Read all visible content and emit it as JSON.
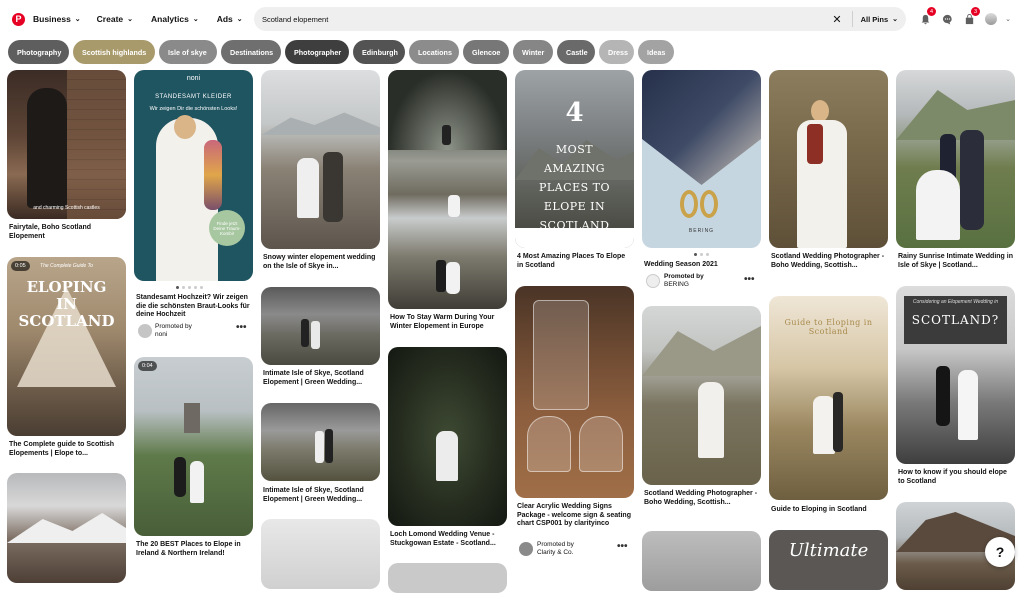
{
  "nav": {
    "business": "Business",
    "create": "Create",
    "analytics": "Analytics",
    "ads": "Ads",
    "search_value": "Scotland elopement",
    "filter": "All Pins",
    "notif_badge": "4",
    "updates_badge": "3"
  },
  "chips": [
    {
      "label": "Photography",
      "color": "#5e5e5e"
    },
    {
      "label": "Scottish highlands",
      "color": "#a89a6a"
    },
    {
      "label": "Isle of skye",
      "color": "#8a8a8a"
    },
    {
      "label": "Destinations",
      "color": "#6f6f6f"
    },
    {
      "label": "Photographer",
      "color": "#3e3e3e"
    },
    {
      "label": "Edinburgh",
      "color": "#535353"
    },
    {
      "label": "Locations",
      "color": "#8c8c8c"
    },
    {
      "label": "Glencoe",
      "color": "#777777"
    },
    {
      "label": "Winter",
      "color": "#868686"
    },
    {
      "label": "Castle",
      "color": "#6a6a6a"
    },
    {
      "label": "Dress",
      "color": "#b5b5b5"
    },
    {
      "label": "Ideas",
      "color": "#a3a3a3"
    }
  ],
  "pins": {
    "c1p1": {
      "overlay": "and charming Scottish castles",
      "caption": "Fairytale, Boho Scotland Elopement"
    },
    "c1p2": {
      "video_time": "0:05",
      "overlay_sub": "The Complete Guide To",
      "overlay_title": "ELOPING IN SCOTLAND",
      "caption": "The Complete guide to Scottish Elopements | Elope to..."
    },
    "c2p1": {
      "brand": "noni",
      "brand_sub": "STANDESAMT KLEIDER",
      "tagline": "Wir zeigen Dir die schönsten Looks!",
      "badge_text": "Finde jetzt Deine Traum-Kombi!",
      "caption": "Standesamt Hochzeit? Wir zeigen die die schönsten Braut-Looks für deine Hochzeit",
      "promoted": "Promoted by",
      "promoter": "noni"
    },
    "c2p2": {
      "video_time": "0:04",
      "caption": "The 20 BEST Places to Elope in Ireland & Northern Ireland!"
    },
    "c3p1": {
      "caption": "Snowy winter elopement wedding on the Isle of Skye in..."
    },
    "c3p2": {
      "caption": "Intimate Isle of Skye, Scotland Elopement | Green Wedding..."
    },
    "c3p3": {
      "caption": "Intimate Isle of Skye, Scotland Elopement | Green Wedding..."
    },
    "c4p1": {
      "caption": "How To Stay Warm During Your Winter Elopement in Europe"
    },
    "c4p2": {
      "caption": "Loch Lomond Wedding Venue - Stuckgowan Estate - Scotland..."
    },
    "c5p1": {
      "overlay_num": "4",
      "overlay_title": "MOST AMAZING PLACES TO ELOPE IN SCOTLAND",
      "caption": "4 Most Amazing Places To Elope in Scotland"
    },
    "c5p2": {
      "caption": "Clear Acrylic Wedding Signs Package - welcome sign & seating chart CSP001 by clarityinco",
      "promoted": "Promoted by",
      "promoter": "Clarity & Co."
    },
    "c6p1": {
      "brand": "BERING",
      "caption": "Wedding Season 2021",
      "promoted": "Promoted by",
      "promoter": "BERING"
    },
    "c6p2": {
      "caption": "Scotland Wedding Photographer - Boho Wedding, Scottish..."
    },
    "c7p1": {
      "caption": "Scotland Wedding Photographer - Boho Wedding, Scottish..."
    },
    "c7p2": {
      "overlay_title": "Guide to Eloping in Scotland",
      "caption": "Guide to Eloping in Scotland"
    },
    "c7p3": {
      "overlay_title": "Ultimate"
    },
    "c8p1": {
      "caption": "Rainy Sunrise Intimate Wedding in Isle of Skye | Scotland..."
    },
    "c8p2": {
      "overlay_sub": "Considering an Elopement Wedding in",
      "overlay_title": "SCOTLAND?",
      "caption": "How to know if you should elope to Scotland"
    }
  },
  "help": "?"
}
